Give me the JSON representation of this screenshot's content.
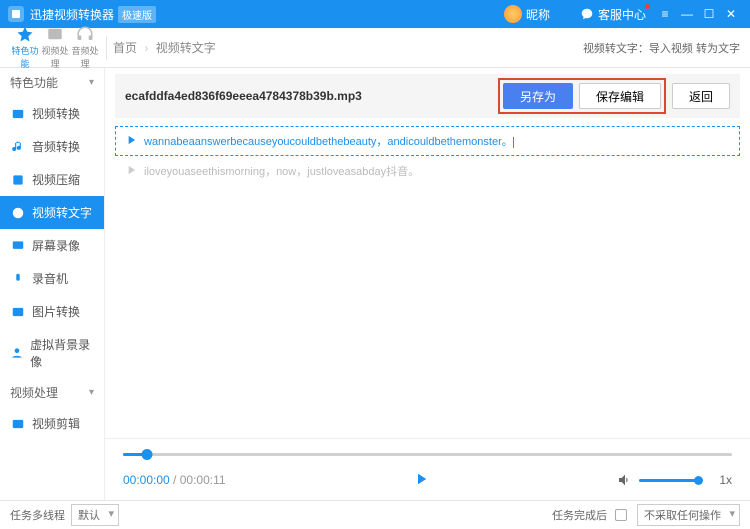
{
  "titlebar": {
    "app_name": "迅捷视频转换器",
    "edition_badge": "极速版",
    "nickname": "昵称",
    "service_center": "客服中心"
  },
  "toolbar": {
    "tabs": [
      "特色功能",
      "视频处理",
      "音频处理"
    ],
    "breadcrumb": {
      "home": "首页",
      "current": "视频转文字"
    },
    "right_hint": "视频转文字：导入视频 转为文字"
  },
  "sidebar": {
    "group1": "特色功能",
    "items1": [
      "视频转换",
      "音频转换",
      "视频压缩",
      "视频转文字",
      "屏幕录像",
      "录音机",
      "图片转换",
      "虚拟背景录像"
    ],
    "group2": "视频处理",
    "items2": [
      "视频剪辑"
    ]
  },
  "file": {
    "name": "ecafddfa4ed836f69eeea4784378b39b.mp3",
    "save_as": "另存为",
    "save_edit": "保存编辑",
    "back": "返回"
  },
  "transcript": {
    "line1": "wannabeaanswerbecauseyoucouldbethebeauty，andicouldbethemonster。",
    "line2": "iloveyouaseethismorning，now，justloveasabday抖音。"
  },
  "player": {
    "current": "00:00:00",
    "total": "00:00:11",
    "speed": "1x"
  },
  "footer": {
    "multithread": "任务多线程",
    "thread_value": "默认",
    "after_task": "任务完成后",
    "after_value": "不采取任何操作"
  }
}
